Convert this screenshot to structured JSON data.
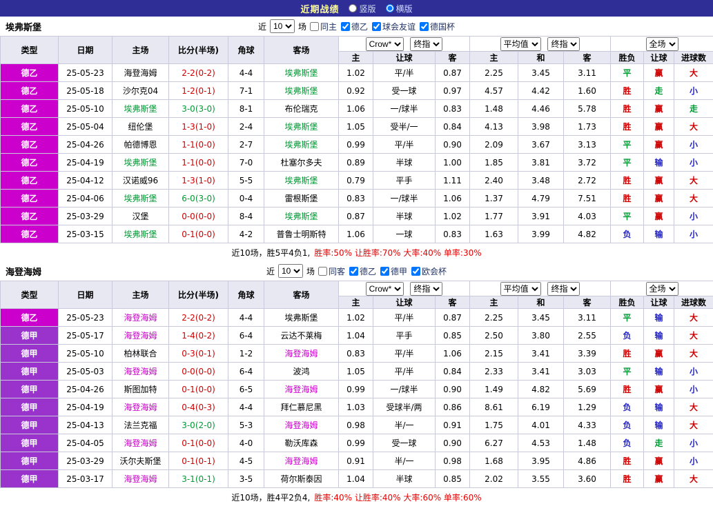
{
  "topbar": {
    "title": "近期战绩",
    "radio_vertical": "竖版",
    "radio_horizontal": "横版"
  },
  "labels": {
    "near": "近",
    "games": "场"
  },
  "table_headers": {
    "type": "类型",
    "date": "日期",
    "home": "主场",
    "score": "比分(半场)",
    "corner": "角球",
    "away": "客场",
    "h": "主",
    "handicap": "让球",
    "a": "客",
    "avg_h": "主",
    "avg_d": "和",
    "avg_a": "客",
    "wdl": "胜负",
    "let_result": "让球",
    "goals": "进球数"
  },
  "league_colors": {
    "德乙": "#cc00cc",
    "德甲": "#9933cc"
  },
  "score_colors": {
    "red": "#cc0000",
    "green": "#009933"
  },
  "result_colors": {
    "胜": "#cc0000",
    "平": "#009933",
    "负": "#2222cc",
    "赢": "#cc0000",
    "输": "#2222cc",
    "走": "#009933",
    "大": "#cc0000",
    "小": "#2222cc"
  },
  "sections": [
    {
      "team": "埃弗斯堡",
      "highlight_color": "#009933",
      "filter": {
        "count": "10",
        "checkboxes": [
          {
            "label": "同主",
            "checked": false
          },
          {
            "label": "德乙",
            "checked": true
          },
          {
            "label": "球会友谊",
            "checked": true
          },
          {
            "label": "德国杯",
            "checked": true
          }
        ]
      },
      "selects": {
        "bookmaker": "Crow*",
        "stage1": "终指",
        "average": "平均值",
        "stage2": "终指",
        "scope": "全场"
      },
      "rows": [
        {
          "league": "德乙",
          "date": "25-05-23",
          "home": "海登海姆",
          "home_hl": false,
          "score": "2-2(0-2)",
          "score_color": "red",
          "corner": "4-4",
          "away": "埃弗斯堡",
          "away_hl": true,
          "odds_home": "1.02",
          "handicap": "平/半",
          "odds_away": "0.87",
          "avg_home": "2.25",
          "avg_draw": "3.45",
          "avg_away": "3.11",
          "result": "平",
          "handicap_result": "赢",
          "goals_result": "大"
        },
        {
          "league": "德乙",
          "date": "25-05-18",
          "home": "沙尔克04",
          "home_hl": false,
          "score": "1-2(0-1)",
          "score_color": "red",
          "corner": "7-1",
          "away": "埃弗斯堡",
          "away_hl": true,
          "odds_home": "0.92",
          "handicap": "受一球",
          "odds_away": "0.97",
          "avg_home": "4.57",
          "avg_draw": "4.42",
          "avg_away": "1.60",
          "result": "胜",
          "handicap_result": "走",
          "goals_result": "小"
        },
        {
          "league": "德乙",
          "date": "25-05-10",
          "home": "埃弗斯堡",
          "home_hl": true,
          "score": "3-0(3-0)",
          "score_color": "green",
          "corner": "8-1",
          "away": "布伦瑞克",
          "away_hl": false,
          "odds_home": "1.06",
          "handicap": "一/球半",
          "odds_away": "0.83",
          "avg_home": "1.48",
          "avg_draw": "4.46",
          "avg_away": "5.78",
          "result": "胜",
          "handicap_result": "赢",
          "goals_result": "走"
        },
        {
          "league": "德乙",
          "date": "25-05-04",
          "home": "纽伦堡",
          "home_hl": false,
          "score": "1-3(1-0)",
          "score_color": "red",
          "corner": "2-4",
          "away": "埃弗斯堡",
          "away_hl": true,
          "odds_home": "1.05",
          "handicap": "受半/一",
          "odds_away": "0.84",
          "avg_home": "4.13",
          "avg_draw": "3.98",
          "avg_away": "1.73",
          "result": "胜",
          "handicap_result": "赢",
          "goals_result": "大"
        },
        {
          "league": "德乙",
          "date": "25-04-26",
          "home": "帕德博恩",
          "home_hl": false,
          "score": "1-1(0-0)",
          "score_color": "red",
          "corner": "2-7",
          "away": "埃弗斯堡",
          "away_hl": true,
          "odds_home": "0.99",
          "handicap": "平/半",
          "odds_away": "0.90",
          "avg_home": "2.09",
          "avg_draw": "3.67",
          "avg_away": "3.13",
          "result": "平",
          "handicap_result": "赢",
          "goals_result": "小"
        },
        {
          "league": "德乙",
          "date": "25-04-19",
          "home": "埃弗斯堡",
          "home_hl": true,
          "score": "1-1(0-0)",
          "score_color": "red",
          "corner": "7-0",
          "away": "杜塞尔多夫",
          "away_hl": false,
          "odds_home": "0.89",
          "handicap": "半球",
          "odds_away": "1.00",
          "avg_home": "1.85",
          "avg_draw": "3.81",
          "avg_away": "3.72",
          "result": "平",
          "handicap_result": "输",
          "goals_result": "小"
        },
        {
          "league": "德乙",
          "date": "25-04-12",
          "home": "汉诺威96",
          "home_hl": false,
          "score": "1-3(1-0)",
          "score_color": "red",
          "corner": "5-5",
          "away": "埃弗斯堡",
          "away_hl": true,
          "odds_home": "0.79",
          "handicap": "平手",
          "odds_away": "1.11",
          "avg_home": "2.40",
          "avg_draw": "3.48",
          "avg_away": "2.72",
          "result": "胜",
          "handicap_result": "赢",
          "goals_result": "大"
        },
        {
          "league": "德乙",
          "date": "25-04-06",
          "home": "埃弗斯堡",
          "home_hl": true,
          "score": "6-0(3-0)",
          "score_color": "green",
          "corner": "0-4",
          "away": "雷根斯堡",
          "away_hl": false,
          "odds_home": "0.83",
          "handicap": "一/球半",
          "odds_away": "1.06",
          "avg_home": "1.37",
          "avg_draw": "4.79",
          "avg_away": "7.51",
          "result": "胜",
          "handicap_result": "赢",
          "goals_result": "大"
        },
        {
          "league": "德乙",
          "date": "25-03-29",
          "home": "汉堡",
          "home_hl": false,
          "score": "0-0(0-0)",
          "score_color": "red",
          "corner": "8-4",
          "away": "埃弗斯堡",
          "away_hl": true,
          "odds_home": "0.87",
          "handicap": "半球",
          "odds_away": "1.02",
          "avg_home": "1.77",
          "avg_draw": "3.91",
          "avg_away": "4.03",
          "result": "平",
          "handicap_result": "赢",
          "goals_result": "小"
        },
        {
          "league": "德乙",
          "date": "25-03-15",
          "home": "埃弗斯堡",
          "home_hl": true,
          "score": "0-1(0-0)",
          "score_color": "red",
          "corner": "4-2",
          "away": "普鲁士明斯特",
          "away_hl": false,
          "odds_home": "1.06",
          "handicap": "一球",
          "odds_away": "0.83",
          "avg_home": "1.63",
          "avg_draw": "3.99",
          "avg_away": "4.82",
          "result": "负",
          "handicap_result": "输",
          "goals_result": "小"
        }
      ],
      "summary": {
        "prefix": "近10场，胜5平4负1,",
        "stats": "胜率:50% 让胜率:70% 大率:40% 单率:30%"
      }
    },
    {
      "team": "海登海姆",
      "highlight_color": "#cc00cc",
      "filter": {
        "count": "10",
        "checkboxes": [
          {
            "label": "同客",
            "checked": false
          },
          {
            "label": "德乙",
            "checked": true
          },
          {
            "label": "德甲",
            "checked": true
          },
          {
            "label": "欧会杯",
            "checked": true
          }
        ]
      },
      "selects": {
        "bookmaker": "Crow*",
        "stage1": "终指",
        "average": "平均值",
        "stage2": "终指",
        "scope": "全场"
      },
      "rows": [
        {
          "league": "德乙",
          "date": "25-05-23",
          "home": "海登海姆",
          "home_hl": true,
          "score": "2-2(0-2)",
          "score_color": "red",
          "corner": "4-4",
          "away": "埃弗斯堡",
          "away_hl": false,
          "odds_home": "1.02",
          "handicap": "平/半",
          "odds_away": "0.87",
          "avg_home": "2.25",
          "avg_draw": "3.45",
          "avg_away": "3.11",
          "result": "平",
          "handicap_result": "输",
          "goals_result": "大"
        },
        {
          "league": "德甲",
          "date": "25-05-17",
          "home": "海登海姆",
          "home_hl": true,
          "score": "1-4(0-2)",
          "score_color": "red",
          "corner": "6-4",
          "away": "云达不莱梅",
          "away_hl": false,
          "odds_home": "1.04",
          "handicap": "平手",
          "odds_away": "0.85",
          "avg_home": "2.50",
          "avg_draw": "3.80",
          "avg_away": "2.55",
          "result": "负",
          "handicap_result": "输",
          "goals_result": "大"
        },
        {
          "league": "德甲",
          "date": "25-05-10",
          "home": "柏林联合",
          "home_hl": false,
          "score": "0-3(0-1)",
          "score_color": "red",
          "corner": "1-2",
          "away": "海登海姆",
          "away_hl": true,
          "odds_home": "0.83",
          "handicap": "平/半",
          "odds_away": "1.06",
          "avg_home": "2.15",
          "avg_draw": "3.41",
          "avg_away": "3.39",
          "result": "胜",
          "handicap_result": "赢",
          "goals_result": "大"
        },
        {
          "league": "德甲",
          "date": "25-05-03",
          "home": "海登海姆",
          "home_hl": true,
          "score": "0-0(0-0)",
          "score_color": "red",
          "corner": "6-4",
          "away": "波鸿",
          "away_hl": false,
          "odds_home": "1.05",
          "handicap": "平/半",
          "odds_away": "0.84",
          "avg_home": "2.33",
          "avg_draw": "3.41",
          "avg_away": "3.03",
          "result": "平",
          "handicap_result": "输",
          "goals_result": "小"
        },
        {
          "league": "德甲",
          "date": "25-04-26",
          "home": "斯图加特",
          "home_hl": false,
          "score": "0-1(0-0)",
          "score_color": "red",
          "corner": "6-5",
          "away": "海登海姆",
          "away_hl": true,
          "odds_home": "0.99",
          "handicap": "一/球半",
          "odds_away": "0.90",
          "avg_home": "1.49",
          "avg_draw": "4.82",
          "avg_away": "5.69",
          "result": "胜",
          "handicap_result": "赢",
          "goals_result": "小"
        },
        {
          "league": "德甲",
          "date": "25-04-19",
          "home": "海登海姆",
          "home_hl": true,
          "score": "0-4(0-3)",
          "score_color": "red",
          "corner": "4-4",
          "away": "拜仁慕尼黑",
          "away_hl": false,
          "odds_home": "1.03",
          "handicap": "受球半/两",
          "odds_away": "0.86",
          "avg_home": "8.61",
          "avg_draw": "6.19",
          "avg_away": "1.29",
          "result": "负",
          "handicap_result": "输",
          "goals_result": "大"
        },
        {
          "league": "德甲",
          "date": "25-04-13",
          "home": "法兰克福",
          "home_hl": false,
          "score": "3-0(2-0)",
          "score_color": "green",
          "corner": "5-3",
          "away": "海登海姆",
          "away_hl": true,
          "odds_home": "0.98",
          "handicap": "半/一",
          "odds_away": "0.91",
          "avg_home": "1.75",
          "avg_draw": "4.01",
          "avg_away": "4.33",
          "result": "负",
          "handicap_result": "输",
          "goals_result": "大"
        },
        {
          "league": "德甲",
          "date": "25-04-05",
          "home": "海登海姆",
          "home_hl": true,
          "score": "0-1(0-0)",
          "score_color": "red",
          "corner": "4-0",
          "away": "勒沃库森",
          "away_hl": false,
          "odds_home": "0.99",
          "handicap": "受一球",
          "odds_away": "0.90",
          "avg_home": "6.27",
          "avg_draw": "4.53",
          "avg_away": "1.48",
          "result": "负",
          "handicap_result": "走",
          "goals_result": "小"
        },
        {
          "league": "德甲",
          "date": "25-03-29",
          "home": "沃尔夫斯堡",
          "home_hl": false,
          "score": "0-1(0-1)",
          "score_color": "red",
          "corner": "4-5",
          "away": "海登海姆",
          "away_hl": true,
          "odds_home": "0.91",
          "handicap": "半/一",
          "odds_away": "0.98",
          "avg_home": "1.68",
          "avg_draw": "3.95",
          "avg_away": "4.86",
          "result": "胜",
          "handicap_result": "赢",
          "goals_result": "小"
        },
        {
          "league": "德甲",
          "date": "25-03-17",
          "home": "海登海姆",
          "home_hl": true,
          "score": "3-1(0-1)",
          "score_color": "green",
          "corner": "3-5",
          "away": "荷尔斯泰因",
          "away_hl": false,
          "odds_home": "1.04",
          "handicap": "半球",
          "odds_away": "0.85",
          "avg_home": "2.02",
          "avg_draw": "3.55",
          "avg_away": "3.60",
          "result": "胜",
          "handicap_result": "赢",
          "goals_result": "大"
        }
      ],
      "summary": {
        "prefix": "近10场，胜4平2负4,",
        "stats": "胜率:40% 让胜率:40% 大率:60% 单率:60%"
      }
    }
  ]
}
